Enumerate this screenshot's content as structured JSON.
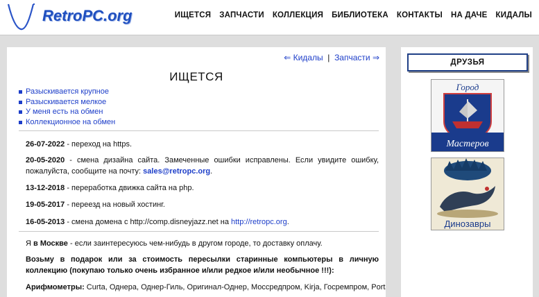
{
  "logo": {
    "text": "RetroPC.org"
  },
  "nav": [
    "ИЩЕТСЯ",
    "ЗАПЧАСТИ",
    "КОЛЛЕКЦИЯ",
    "БИБЛИОТЕКА",
    "КОНТАКТЫ",
    "НА ДАЧЕ",
    "КИДАЛЫ"
  ],
  "pager": {
    "prev": "⇐ Кидалы",
    "sep": "|",
    "next": "Запчасти ⇒"
  },
  "page_title": "ИЩЕТСЯ",
  "links": [
    "Разыскивается крупное",
    "Разыскивается мелкое",
    "У меня есть на обмен",
    "Коллекционное на обмен"
  ],
  "news": [
    {
      "date": "26-07-2022",
      "text": " - переход на https."
    },
    {
      "date": "20-05-2020",
      "text": " - смена дизайна сайта. Замеченные ошибки исправлены. Если увидите ошибку, пожалуйста, сообщите на почту: ",
      "link": "sales@retropc.org",
      "tail": "."
    },
    {
      "date": "13-12-2018",
      "text": " - переработка движка сайта на php."
    },
    {
      "date": "19-05-2017",
      "text": " - переезд на новый хостинг."
    },
    {
      "date": "16-05-2013",
      "text": " - смена домена с http://comp.disneyjazz.net на ",
      "link": "http://retropc.org",
      "tail": "."
    }
  ],
  "para1": {
    "pre": "Я ",
    "bold": "в Москве",
    "post": " - если заинтересуюсь чем-нибудь в другом городе, то доставку оплачу."
  },
  "para2": "Возьму в подарок или за стоимость пересылки старинные компьютеры в личную коллекцию (покупаю только очень избранное и/или редкое и/или необычное !!!):",
  "para3": {
    "bold": "Арифмометры:",
    "text": " Curta, Однера, Однер-Гиль, Оригинал-Однер, Моссредпром, Kirja, Госремпром, Portable, Феликс"
  },
  "sidebar": {
    "title": "ДРУЗЬЯ",
    "banner1": {
      "top": "Город",
      "bottom": "Мастеров"
    },
    "banner2": {
      "caption": "Динозавры"
    }
  },
  "colors": {
    "link": "#1d3ec9",
    "logo": "#1f4fbf",
    "frame": "#1f3f86"
  }
}
